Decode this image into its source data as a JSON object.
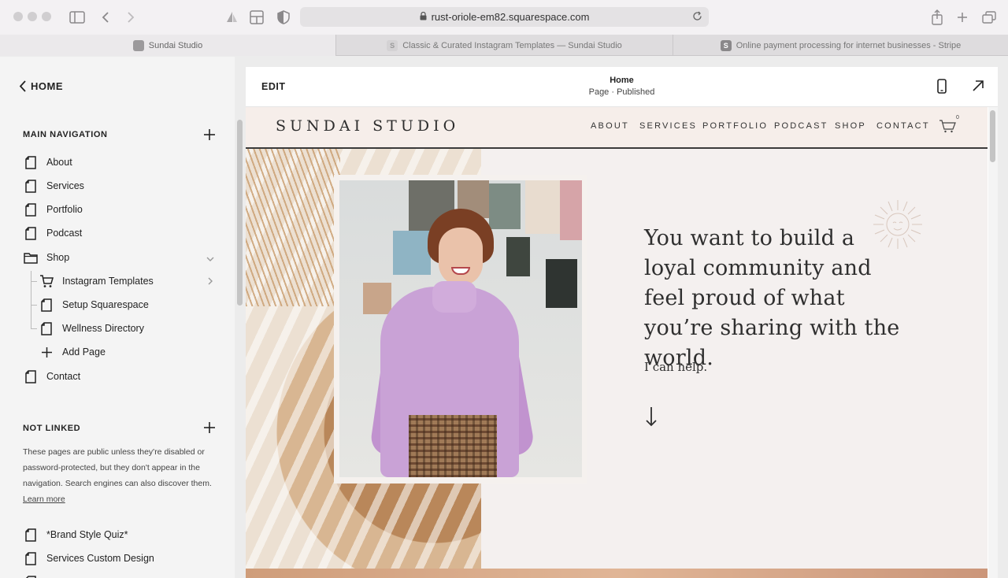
{
  "browser": {
    "url": "rust-oriole-em82.squarespace.com",
    "tabs": [
      {
        "title": "Sundai Studio",
        "active": true
      },
      {
        "title": "Classic & Curated Instagram Templates — Sundai Studio",
        "active": false
      },
      {
        "title": "Online payment processing for internet businesses - Stripe",
        "active": false
      }
    ]
  },
  "sidebar": {
    "back_label": "HOME",
    "main_nav_title": "MAIN NAVIGATION",
    "main_nav": [
      {
        "label": "About",
        "icon": "page-icon"
      },
      {
        "label": "Services",
        "icon": "page-icon"
      },
      {
        "label": "Portfolio",
        "icon": "page-icon"
      },
      {
        "label": "Podcast",
        "icon": "page-icon"
      },
      {
        "label": "Shop",
        "icon": "folder-icon"
      },
      {
        "label": "Instagram Templates",
        "icon": "cart-icon"
      },
      {
        "label": "Setup Squarespace",
        "icon": "page-icon"
      },
      {
        "label": "Wellness Directory",
        "icon": "page-icon"
      },
      {
        "label": "Add Page",
        "icon": "plus-icon"
      },
      {
        "label": "Contact",
        "icon": "page-icon"
      }
    ],
    "not_linked_title": "NOT LINKED",
    "not_linked_desc": "These pages are public unless they're disabled or password-protected, but they don't appear in the navigation. Search engines can also discover them.",
    "learn_more": "Learn more",
    "not_linked": [
      {
        "label": "*Brand Style Quiz*"
      },
      {
        "label": "Services Custom Design"
      }
    ]
  },
  "editor": {
    "edit_label": "EDIT",
    "page_title": "Home",
    "page_status": "Page · Published"
  },
  "site": {
    "logo": "SUNDAI STUDIO",
    "nav": [
      "ABOUT",
      "SERVICES",
      "PORTFOLIO",
      "PODCAST",
      "SHOP",
      "CONTACT"
    ],
    "cart_count": "0",
    "headline": "You want to build a loyal community and feel proud of what you’re sharing with the world.",
    "subhead": "I can help."
  },
  "colors": {
    "header_bg": "#f6eeea",
    "page_bg": "#f4f0ef",
    "accent": "#cf9d7a",
    "sweater": "#c9a2d6"
  }
}
